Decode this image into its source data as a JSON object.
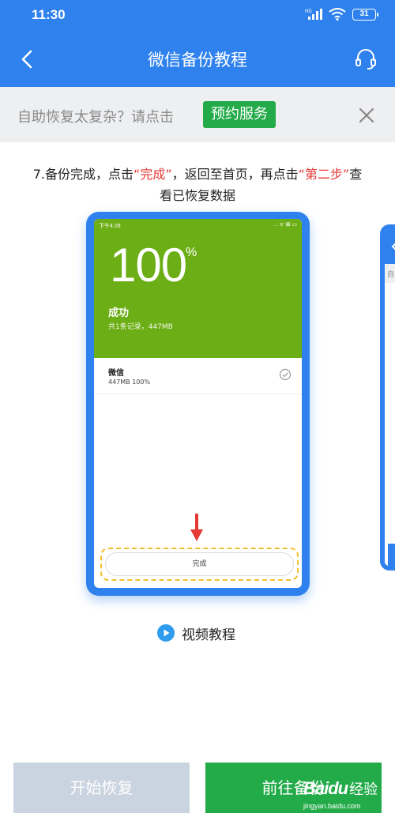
{
  "status": {
    "time": "11:30",
    "battery": "31",
    "network": "HD"
  },
  "nav": {
    "title": "微信备份教程",
    "back_icon": "chevron-left-icon",
    "service_icon": "headset-icon"
  },
  "banner": {
    "text": "自助恢复太复杂？请点击",
    "button": "预约服务",
    "close_icon": "close-icon"
  },
  "step": {
    "prefix": "7.备份完成，点击",
    "highlight1": "“完成”",
    "middle": "，返回至首页，再点击",
    "highlight2": "“第二步”",
    "suffix": "查看已恢复数据",
    "highlight_color": "#e53935"
  },
  "screenshot": {
    "status_left": "下午4:28",
    "status_right": "... ᯤ ⊠ ▭",
    "percent": "100",
    "percent_sign": "%",
    "success": "成功",
    "records": "共1条记录，447MB",
    "item_name": "微信",
    "item_size": "447MB 100%",
    "done_button": "完成"
  },
  "peek": {
    "banner_char": "自"
  },
  "video": {
    "label": "视频教程",
    "icon": "play-icon"
  },
  "actions": {
    "restore": "开始恢复",
    "backup": "前往备份"
  },
  "watermark": {
    "logo": "Baidu",
    "sub": "经验",
    "url": "jingyan.baidu.com"
  },
  "colors": {
    "primary": "#2f82ee",
    "green": "#23ab4a",
    "screen_green": "#6cae15",
    "disabled": "#cad3e0"
  }
}
